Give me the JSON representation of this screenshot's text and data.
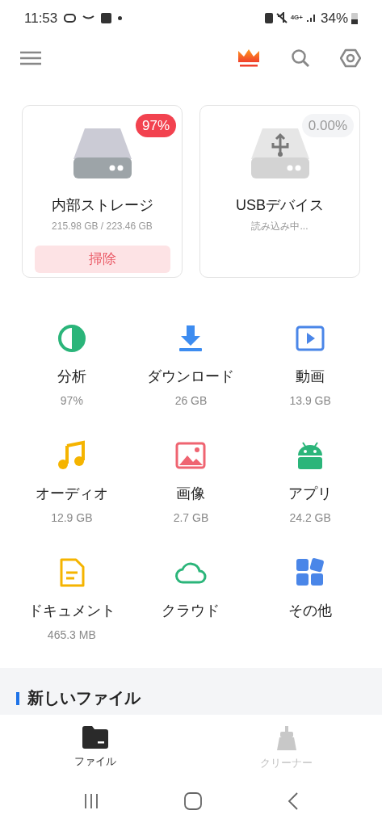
{
  "status_bar": {
    "time": "11:53",
    "network": "4G+",
    "battery": "34%"
  },
  "storage": [
    {
      "kind": "internal",
      "name": "内部ストレージ",
      "badge": "97%",
      "detail": "215.98 GB / 223.46 GB",
      "action": "掃除"
    },
    {
      "kind": "usb",
      "name": "USBデバイス",
      "badge": "0.00%",
      "detail": "読み込み中..."
    }
  ],
  "categories": [
    {
      "kind": "analysis",
      "label": "分析",
      "size": "97%",
      "color": "#2bb57a"
    },
    {
      "kind": "download",
      "label": "ダウンロード",
      "size": "26 GB",
      "color": "#3d8cf0"
    },
    {
      "kind": "video",
      "label": "動画",
      "size": "13.9 GB",
      "color": "#4a86e8"
    },
    {
      "kind": "audio",
      "label": "オーディオ",
      "size": "12.9 GB",
      "color": "#f5b400"
    },
    {
      "kind": "image",
      "label": "画像",
      "size": "2.7 GB",
      "color": "#ef6471"
    },
    {
      "kind": "app",
      "label": "アプリ",
      "size": "24.2 GB",
      "color": "#2bb57a"
    },
    {
      "kind": "document",
      "label": "ドキュメント",
      "size": "465.3 MB",
      "color": "#f5b400"
    },
    {
      "kind": "cloud",
      "label": "クラウド",
      "color": "#2bb57a"
    },
    {
      "kind": "other",
      "label": "その他",
      "color": "#4a86e8"
    }
  ],
  "section_title": "新しいファイル",
  "nav": [
    {
      "kind": "files",
      "label": "ファイル",
      "selected": true
    },
    {
      "kind": "cleaner",
      "label": "クリーナー",
      "selected": false
    }
  ]
}
